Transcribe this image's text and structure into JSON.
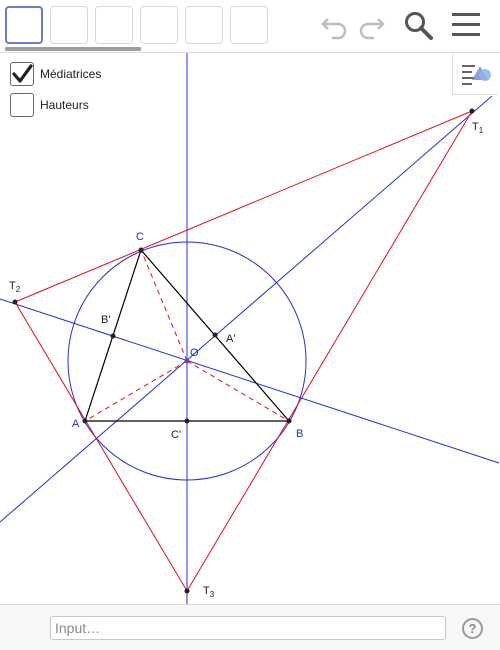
{
  "toolbar": {
    "tool_buttons": [
      "tool-1",
      "tool-2",
      "tool-3",
      "tool-4",
      "tool-5",
      "tool-6"
    ],
    "icons": [
      "undo-icon",
      "redo-icon",
      "search-icon",
      "menu-icon"
    ]
  },
  "checkboxes": [
    {
      "label": "Médiatrices",
      "checked": true
    },
    {
      "label": "Hauteurs",
      "checked": false
    }
  ],
  "geometry": {
    "points": {
      "A": "A",
      "B": "B",
      "C": "C",
      "A_prime": "A'",
      "B_prime": "B'",
      "C_prime": "C'",
      "O": "O"
    },
    "tangent_points": {
      "T1": "T",
      "T2": "T",
      "T3": "T"
    },
    "subscripts": {
      "s1": "1",
      "s2": "2",
      "s3": "3"
    }
  },
  "colors": {
    "blue": "#2530d8",
    "red": "#e01020",
    "black": "#000000",
    "label_blue": "#1f2bd0"
  },
  "input_bar": {
    "placeholder": "Input…",
    "help": "?"
  },
  "style_bar": {
    "icon": "style-bar-icon"
  }
}
